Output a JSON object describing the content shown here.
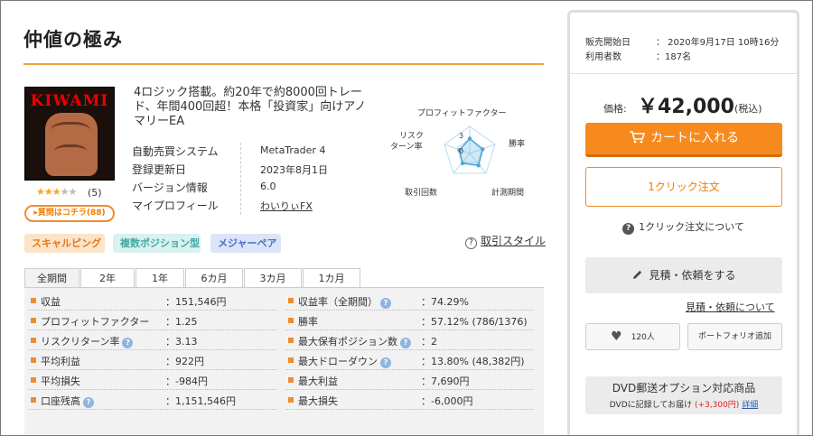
{
  "product": {
    "title": "仲値の極み",
    "logo_text": "KIWAMI",
    "rating": 3,
    "rating_max": 5,
    "rating_count": "(5)",
    "question_label": "▸質問はコチラ(88)",
    "description": "4ロジック搭載。約20年で約8000回トレード、年間400回超！本格「投資家」向けアノマリーEA"
  },
  "spec": {
    "rows": [
      {
        "label": "自動売買システム",
        "value": "MetaTrader 4"
      },
      {
        "label": "登録更新日",
        "value": "2023年8月1日"
      },
      {
        "label": "バージョン情報",
        "value": "6.0"
      },
      {
        "label": "マイプロフィール",
        "value": "わいりぃFX"
      }
    ]
  },
  "radar": {
    "labels": {
      "profit_factor": "プロフィットファクター",
      "risk_return_1": "リスク",
      "risk_return_2": "ターン率",
      "win_rate": "勝率",
      "trade_count": "取引回数",
      "period": "計測期間"
    },
    "scale_max": "3",
    "scale_min": "0",
    "values": [
      0.55,
      0.5,
      0.55,
      0.45,
      0.4
    ],
    "color": "#4aa6d8"
  },
  "tags": [
    "スキャルピング",
    "複数ポジション型",
    "メジャーペア"
  ],
  "style_link": "取引スタイル",
  "tabs": [
    "全期間",
    "2年",
    "1年",
    "6カ月",
    "3カ月",
    "1カ月"
  ],
  "stats": {
    "left": [
      {
        "label": "収益",
        "value": "：151,546円",
        "help": false
      },
      {
        "label": "プロフィットファクター",
        "value": "：1.25",
        "help": false
      },
      {
        "label": "リスクリターン率",
        "value": "：3.13",
        "help": true
      },
      {
        "label": "平均利益",
        "value": "：922円",
        "help": false
      },
      {
        "label": "平均損失",
        "value": "：-984円",
        "help": false
      },
      {
        "label": "口座残高",
        "value": "：1,151,546円",
        "help": true
      }
    ],
    "right": [
      {
        "label": "収益率（全期間）",
        "value": "：74.29%",
        "help": true
      },
      {
        "label": "勝率",
        "value": "：57.12% (786/1376)",
        "help": false
      },
      {
        "label": "最大保有ポジション数",
        "value": "：2",
        "help": true
      },
      {
        "label": "最大ドローダウン",
        "value": "：13.80% (48,382円)",
        "help": true
      },
      {
        "label": "最大利益",
        "value": "：7,690円",
        "help": false
      },
      {
        "label": "最大損失",
        "value": "：-6,000円",
        "help": false
      }
    ]
  },
  "sidebar": {
    "release_label": "販売開始日",
    "release_value": "：  2020年9月17日 10時16分",
    "users_label": "利用者数",
    "users_value": "：187名",
    "price_label": "価格:",
    "price": "￥42,000",
    "tax": "(税込)",
    "cart_label": "カートに入れる",
    "oneclick_label": "1クリック注文",
    "oneclick_about": "1クリック注文について",
    "estimate_label": "見積・依頼をする",
    "estimate_link": "見積・依頼について",
    "fav_count": "120人",
    "portfolio_label": "ポートフォリオ追加",
    "dvd_title": "DVD郵送オプション対応商品",
    "dvd_sub_1": "DVDに記録してお届け",
    "dvd_price": "(+3,300円)",
    "dvd_detail": "詳細",
    "accent": "#f78a1d"
  }
}
